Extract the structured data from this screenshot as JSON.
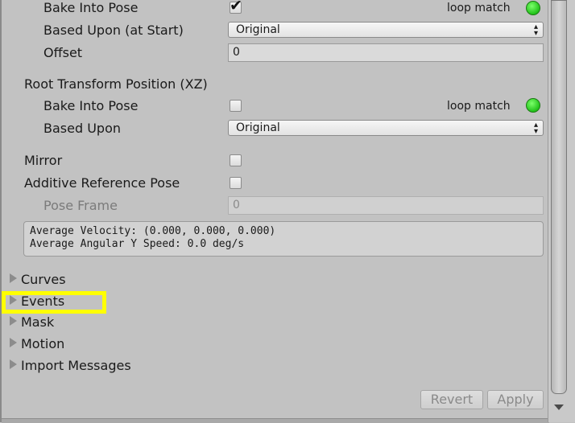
{
  "root_y": {
    "bake_label": "Bake Into Pose",
    "bake_checked": true,
    "loop_match_label": "loop match",
    "based_upon_label": "Based Upon (at Start)",
    "based_upon_value": "Original",
    "offset_label": "Offset",
    "offset_value": "0"
  },
  "root_xz": {
    "section_label": "Root Transform Position (XZ)",
    "bake_label": "Bake Into Pose",
    "bake_checked": false,
    "loop_match_label": "loop match",
    "based_upon_label": "Based Upon",
    "based_upon_value": "Original"
  },
  "mirror_label": "Mirror",
  "additive_label": "Additive Reference Pose",
  "pose_frame_label": "Pose Frame",
  "pose_frame_value": "0",
  "info": {
    "line1": "Average Velocity: (0.000, 0.000, 0.000)",
    "line2": "Average Angular Y Speed: 0.0 deg/s"
  },
  "foldouts": [
    "Curves",
    "Events",
    "Mask",
    "Motion",
    "Import Messages"
  ],
  "buttons": {
    "revert": "Revert",
    "apply": "Apply"
  },
  "colors": {
    "highlight": "#ffff00",
    "loop_match_ok": "#33dd22"
  },
  "icons": {
    "dropdown": "updown-arrows-icon",
    "foldout": "triangle-right-icon",
    "loop": "green-circle-icon"
  }
}
